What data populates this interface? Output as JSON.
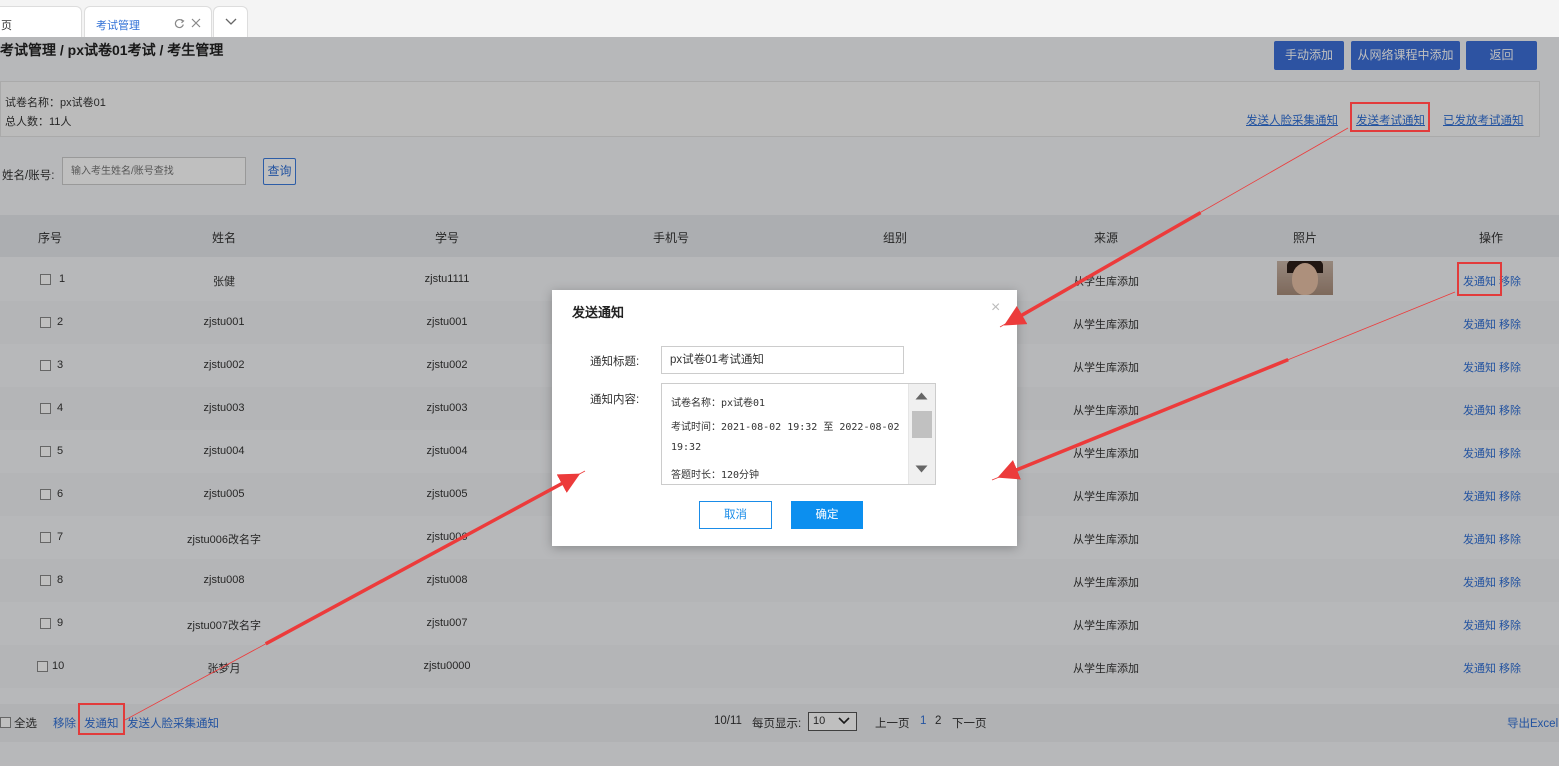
{
  "tabs": [
    {
      "label": "页"
    },
    {
      "label": "考试管理"
    }
  ],
  "breadcrumb": "考试管理 / px试卷01考试 / 考生管理",
  "actions": {
    "manual_add": "手动添加",
    "add_from_course": "从网络课程中添加",
    "back": "返回"
  },
  "info": {
    "paper_name": "试卷名称：px试卷01",
    "total": "总人数：11人"
  },
  "notify_links": {
    "face": "发送人脸采集通知",
    "exam": "发送考试通知",
    "sent": "已发放考试通知"
  },
  "search": {
    "label": "姓名/账号:",
    "placeholder": "输入考生姓名/账号查找",
    "button": "查询"
  },
  "table": {
    "headers": [
      "序号",
      "姓名",
      "学号",
      "手机号",
      "组别",
      "来源",
      "照片",
      "操作"
    ],
    "rows": [
      {
        "no": "1",
        "name": "张健",
        "id": "zjstu1111",
        "source": "从学生库添加"
      },
      {
        "no": "2",
        "name": "zjstu001",
        "id": "zjstu001",
        "source": "从学生库添加"
      },
      {
        "no": "3",
        "name": "zjstu002",
        "id": "zjstu002",
        "source": "从学生库添加"
      },
      {
        "no": "4",
        "name": "zjstu003",
        "id": "zjstu003",
        "source": "从学生库添加"
      },
      {
        "no": "5",
        "name": "zjstu004",
        "id": "zjstu004",
        "source": "从学生库添加"
      },
      {
        "no": "6",
        "name": "zjstu005",
        "id": "zjstu005",
        "source": "从学生库添加"
      },
      {
        "no": "7",
        "name": "zjstu006改名字",
        "id": "zjstu006",
        "source": "从学生库添加"
      },
      {
        "no": "8",
        "name": "zjstu008",
        "id": "zjstu008",
        "source": "从学生库添加"
      },
      {
        "no": "9",
        "name": "zjstu007改名字",
        "id": "zjstu007",
        "source": "从学生库添加"
      },
      {
        "no": "10",
        "name": "张梦月",
        "id": "zjstu0000",
        "source": "从学生库添加"
      }
    ],
    "op_notify": "发通知",
    "op_remove": "移除"
  },
  "footer": {
    "select_all": "全选",
    "remove": "移除",
    "notify": "发通知",
    "face_notify": "发送人脸采集通知",
    "count": "10/11",
    "per_page_label": "每页显示:",
    "per_page_value": "10",
    "prev": "上一页",
    "page1": "1",
    "page2": "2",
    "next": "下一页",
    "export": "导出Excel"
  },
  "modal": {
    "title": "发送通知",
    "close": "×",
    "title_label": "通知标题:",
    "title_value": "px试卷01考试通知",
    "content_label": "通知内容:",
    "content_lines": [
      "试卷名称：px试卷01",
      "考试时间：2021-08-02 19:32 至 2022-08-02",
      "19:32",
      "答题时长：120分钟"
    ],
    "cancel": "取消",
    "ok": "确定"
  },
  "colors": {
    "accent": "#3c6fd8",
    "link": "#2f6fd6",
    "annotation": "#e23b3b"
  }
}
